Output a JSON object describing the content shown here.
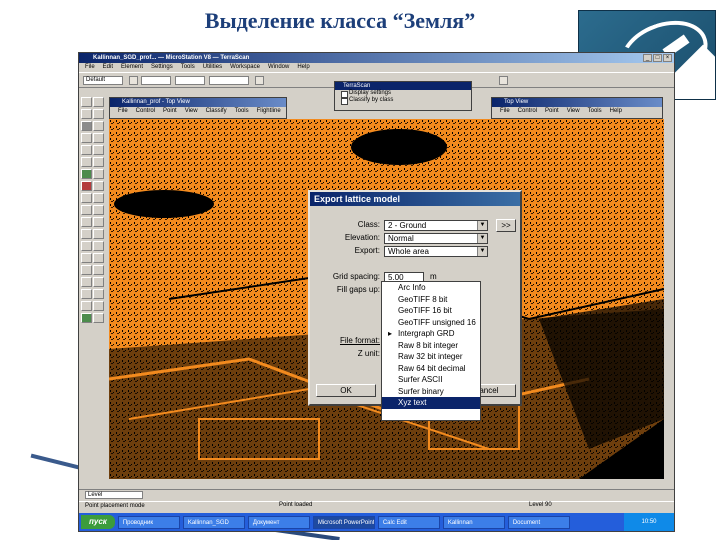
{
  "slide": {
    "title": "Выделение класса “Земля”"
  },
  "app": {
    "title": "Kallinnan_SGD_prof... — MicroStation V8 — TerraScan",
    "menu": [
      "File",
      "Edit",
      "Element",
      "Settings",
      "Tools",
      "Utilities",
      "Workspace",
      "Window",
      "Help"
    ],
    "toolbar_field": "Default",
    "popup": {
      "title": "TerraScan",
      "options": [
        "Display settings",
        "Classify by class"
      ]
    },
    "view_left": {
      "title": "Kallinnan_prof - Top View",
      "menu": [
        "File",
        "Control",
        "Point",
        "View",
        "Classify",
        "Tools",
        "Flightline"
      ]
    },
    "view_right": {
      "title": "Top View",
      "menu": [
        "File",
        "Control",
        "Point",
        "View",
        "Tools",
        "Help"
      ]
    },
    "status_combo": "Level",
    "status_text": "Point placement mode",
    "status_center": "Point loaded",
    "status_level": "Level 90"
  },
  "dialog": {
    "title": "Export lattice model",
    "fields": {
      "class_label": "Class:",
      "class_value": "2 - Ground",
      "elevation_label": "Elevation:",
      "elevation_value": "Normal",
      "export_label": "Export:",
      "export_value": "Whole area",
      "grid_spacing_label": "Grid spacing:",
      "grid_spacing_value": "5.00",
      "grid_spacing_unit": "m",
      "fill_gaps_label": "Fill gaps up:",
      "file_format_label": "File format:",
      "z_unit_label": "Z unit:"
    },
    "browse_label": ">>",
    "ok_label": "OK",
    "cancel_label": "Cancel"
  },
  "format_list": {
    "items": [
      "Arc Info",
      "GeoTIFF 8 bit",
      "GeoTIFF 16 bit",
      "GeoTIFF unsigned 16",
      "Intergraph GRD",
      "Raw 8 bit integer",
      "Raw 32 bit integer",
      "Raw 64 bit decimal",
      "Surfer ASCII",
      "Surfer binary",
      "Xyz text"
    ],
    "marked_index": 4,
    "selected_index": 10
  },
  "taskbar": {
    "start_label": "пуск",
    "tasks": [
      "Проводник",
      "Kallinnan_SGD",
      "Документ",
      "Microsoft PowerPoint",
      "Calc Edit",
      "Kallinnan",
      "Document"
    ],
    "tray_time": "10:50"
  },
  "colors": {
    "title_blue": "#1d3f7a",
    "lidar_orange": "#f28a1e",
    "dialog_title": "#0a246a",
    "taskbar": "#245edb"
  }
}
